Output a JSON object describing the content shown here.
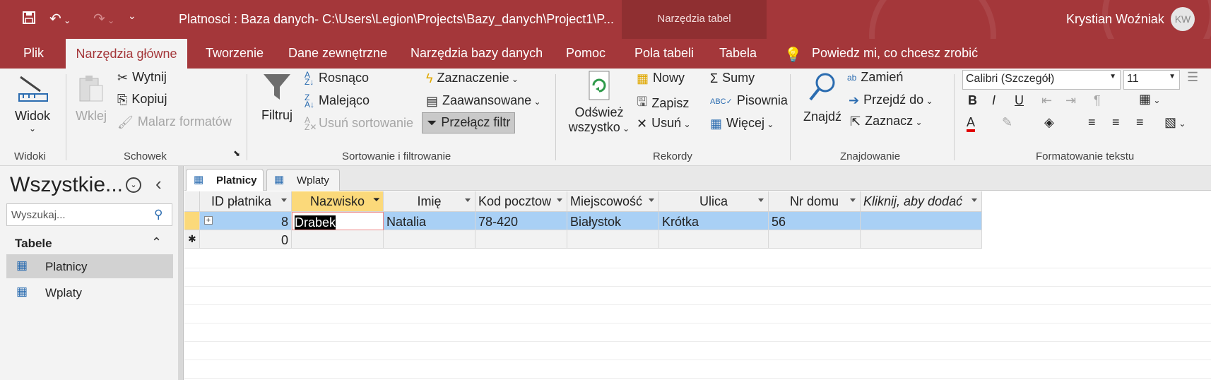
{
  "window": {
    "title": "Platnosci : Baza danych- C:\\Users\\Legion\\Projects\\Bazy_danych\\Project1\\P...",
    "context_group": "Narzędzia tabel",
    "user": "Krystian Woźniak",
    "avatar": "KW"
  },
  "tabs": [
    "Plik",
    "Narzędzia główne",
    "Tworzenie",
    "Dane zewnętrzne",
    "Narzędzia bazy danych",
    "Pomoc",
    "Pola tabeli",
    "Tabela"
  ],
  "active_tab": "Narzędzia główne",
  "tell_me": "Powiedz mi, co chcesz zrobić",
  "ribbon": {
    "widoki": {
      "label": "Widoki",
      "widok": "Widok"
    },
    "schowek": {
      "label": "Schowek",
      "wklej": "Wklej",
      "wytnij": "Wytnij",
      "kopiuj": "Kopiuj",
      "malarz": "Malarz formatów"
    },
    "sortowanie": {
      "label": "Sortowanie i filtrowanie",
      "filtruj": "Filtruj",
      "rosnaco": "Rosnąco",
      "malejaco": "Malejąco",
      "usun_sort": "Usuń sortowanie",
      "zaznaczenie": "Zaznaczenie",
      "zaawansowane": "Zaawansowane",
      "przelacz": "Przełącz filtr"
    },
    "rekordy": {
      "label": "Rekordy",
      "odswiez1": "Odśwież",
      "odswiez2": "wszystko",
      "nowy": "Nowy",
      "zapisz": "Zapisz",
      "usun": "Usuń",
      "sumy": "Sumy",
      "pisownia": "Pisownia",
      "wiecej": "Więcej"
    },
    "znajdowanie": {
      "label": "Znajdowanie",
      "znajdz": "Znajdź",
      "zamien": "Zamień",
      "przejdz": "Przejdź do",
      "zaznacz": "Zaznacz"
    },
    "formatowanie": {
      "label": "Formatowanie tekstu",
      "font": "Calibri (Szczegół)",
      "size": "11",
      "bold": "B",
      "italic": "I",
      "underline": "U"
    }
  },
  "nav": {
    "title": "Wszystkie...",
    "search_placeholder": "Wyszukaj...",
    "category": "Tabele",
    "items": [
      "Platnicy",
      "Wplaty"
    ]
  },
  "doc_tabs": [
    "Platnicy",
    "Wplaty"
  ],
  "table": {
    "columns": [
      "ID płatnika",
      "Nazwisko",
      "Imię",
      "Kod pocztow",
      "Miejscowość",
      "Ulica",
      "Nr domu",
      "Kliknij, aby dodać"
    ],
    "row": {
      "id": "8",
      "nazwisko": "Drabek",
      "imie": "Natalia",
      "kod": "78-420",
      "miejscowosc": "Białystok",
      "ulica": "Krótka",
      "nr": "56"
    },
    "new_row_id": "0"
  },
  "colors": {
    "accent": "#a4373a",
    "context": "#8f2f31",
    "selection": "#a9d0f5",
    "row_selector": "#fbd97a"
  }
}
